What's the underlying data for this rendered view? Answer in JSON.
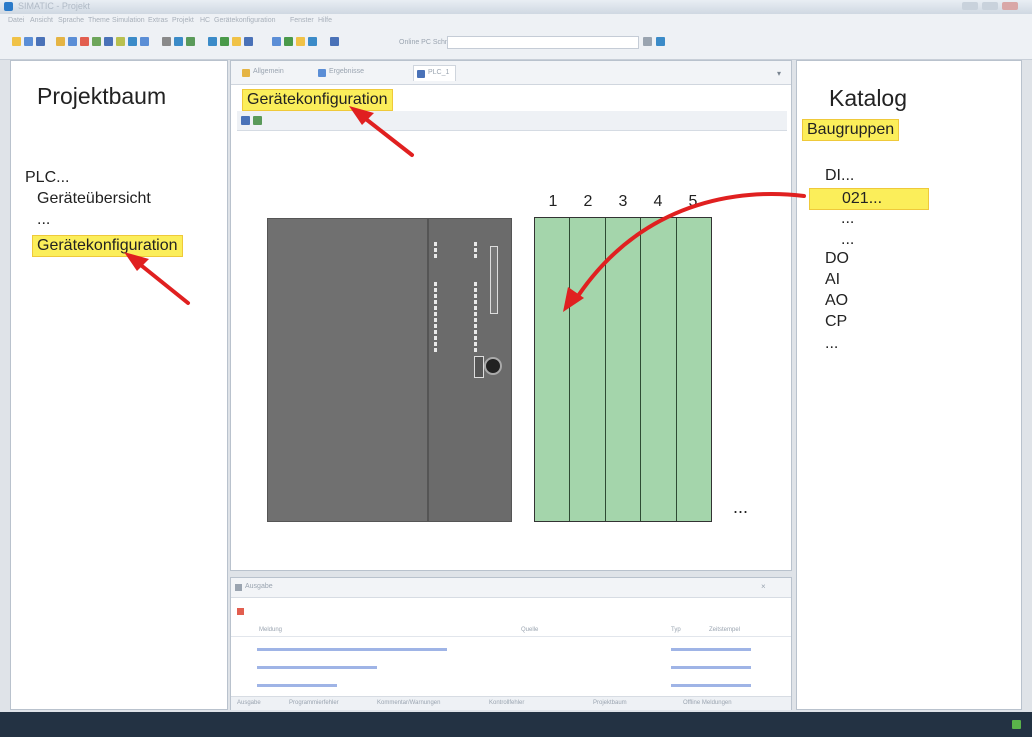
{
  "window": {
    "title": "SIMATIC - Projekt"
  },
  "menubar": [
    "Datei",
    "Ansicht",
    "Sprache",
    "Theme",
    "Simulation",
    "Extras",
    "Projekt",
    "HC",
    "Gerätekonfiguration",
    "Fenster",
    "Hilfe"
  ],
  "toolbar": {
    "label": "Online PC Schnittstelle",
    "select_value": ""
  },
  "left_panel": {
    "title": "Projektbaum",
    "items": [
      "PLC...",
      "Geräteübersicht",
      "...",
      "Gerätekonfiguration"
    ]
  },
  "center_panel": {
    "tabs": [
      "Allgemein",
      "Ergebnisse",
      "PLC_1"
    ],
    "header_label": "Gerätekonfiguration",
    "slot_numbers": [
      "1",
      "2",
      "3",
      "4",
      "5"
    ],
    "ellipsis": "..."
  },
  "right_panel": {
    "title": "Katalog",
    "subtitle": "Baugruppen",
    "items": [
      "DI...",
      "021...",
      "...",
      "...",
      "DO",
      "AI",
      "AO",
      "CP",
      "..."
    ]
  },
  "output_panel": {
    "title": "Ausgabe",
    "columns": [
      "Meldung",
      "Quelle",
      "Typ",
      "Zeitstempel"
    ],
    "tabs": [
      "Ausgabe",
      "Programmierfehler",
      "Kommentar/Warnungen",
      "Kontrollfehler",
      "Projektbaum",
      "Offline Meldungen"
    ]
  },
  "statusbar": {
    "left": "",
    "right": ""
  },
  "colors": {
    "highlight": "#fbee5a",
    "slot_green": "#a4d5ab",
    "arrow": "#e02020",
    "module_gray": "#707070"
  }
}
